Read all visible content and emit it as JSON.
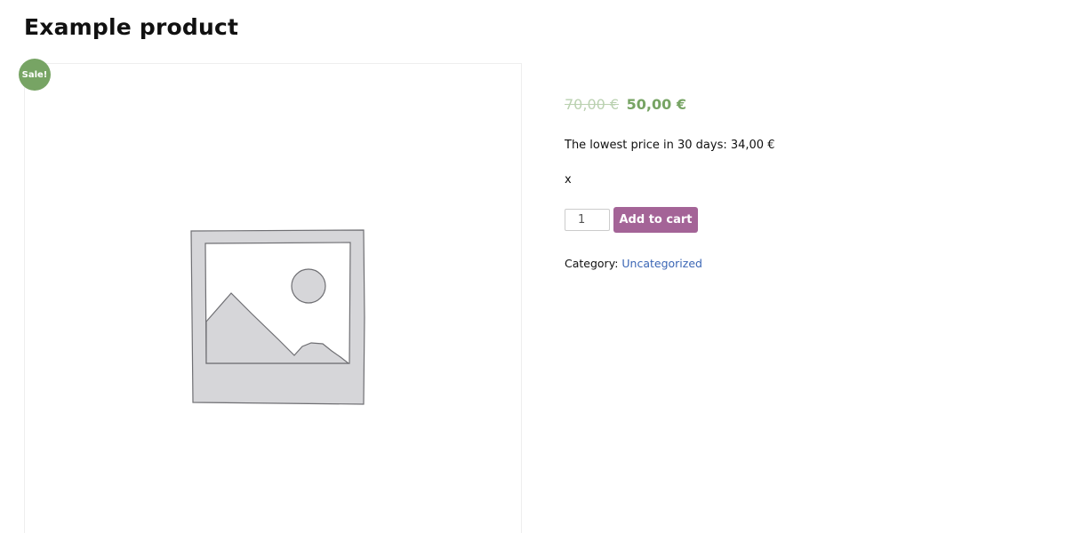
{
  "product": {
    "title": "Example product",
    "sale_badge": "Sale!",
    "price": {
      "regular": "70,00 €",
      "sale": "50,00 €"
    },
    "lowest_price_text": "The lowest price in 30 days: 34,00 €",
    "extra_text": "x",
    "quantity": "1",
    "add_to_cart_label": "Add to cart",
    "category_label": "Category:",
    "category_link": "Uncategorized"
  },
  "colors": {
    "sale_green": "#77a464",
    "button_purple": "#a46497",
    "link_blue": "#3b66b5"
  },
  "icons": {
    "placeholder_image": "image-placeholder-icon"
  }
}
